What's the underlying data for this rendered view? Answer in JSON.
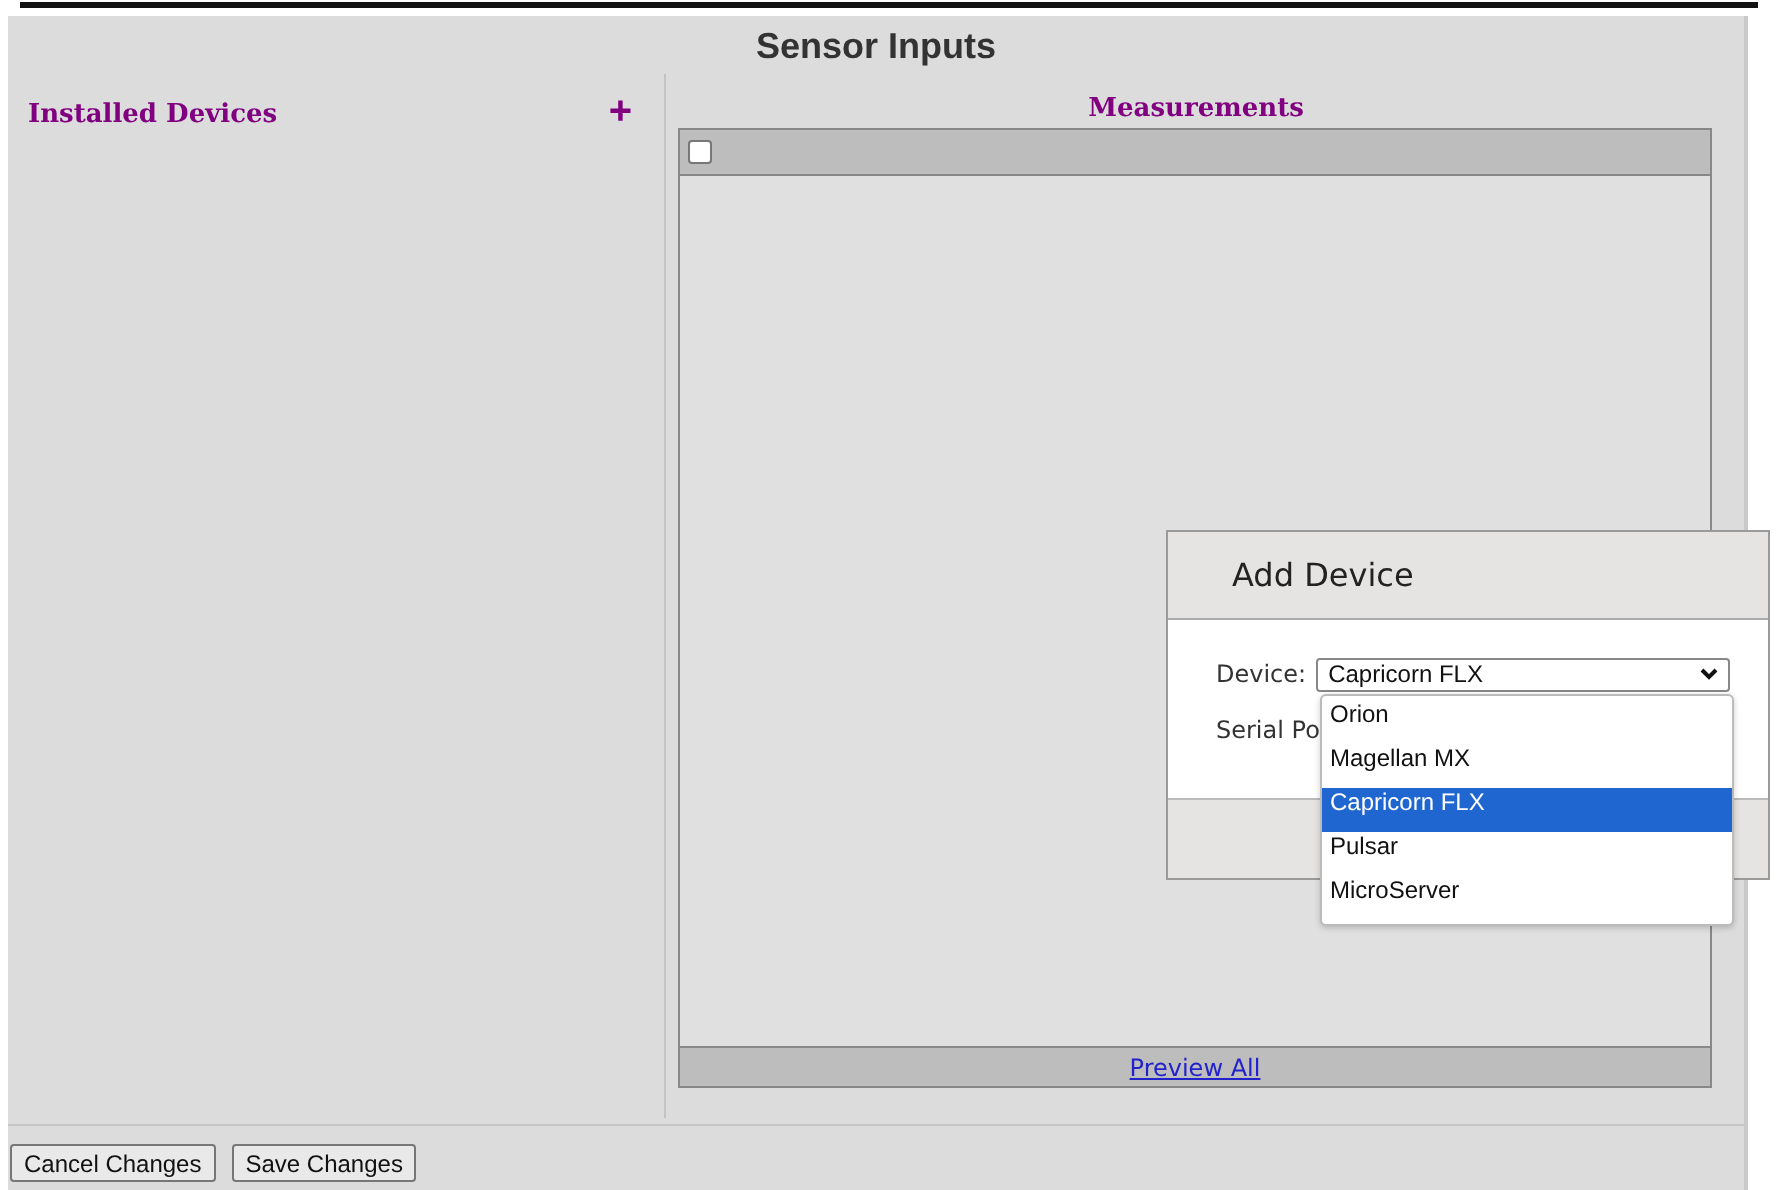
{
  "title": "Sensor Inputs",
  "installed_devices": {
    "heading": "Installed Devices",
    "add_icon": "+"
  },
  "measurements": {
    "heading": "Measurements",
    "select_all": {
      "checked": false
    },
    "footer_link": "Preview All"
  },
  "dialog": {
    "title": "Add Device",
    "device": {
      "label": "Device:",
      "value": "Capricorn FLX"
    },
    "serial_port": {
      "label": "Serial Po"
    },
    "dropdown": [
      {
        "label": "Orion",
        "selected": false
      },
      {
        "label": "Magellan MX",
        "selected": false
      },
      {
        "label": "Capricorn FLX",
        "selected": true
      },
      {
        "label": "Pulsar",
        "selected": false
      },
      {
        "label": "MicroServer",
        "selected": false
      }
    ]
  },
  "buttons": [
    "Cancel Changes",
    "Save Changes"
  ]
}
